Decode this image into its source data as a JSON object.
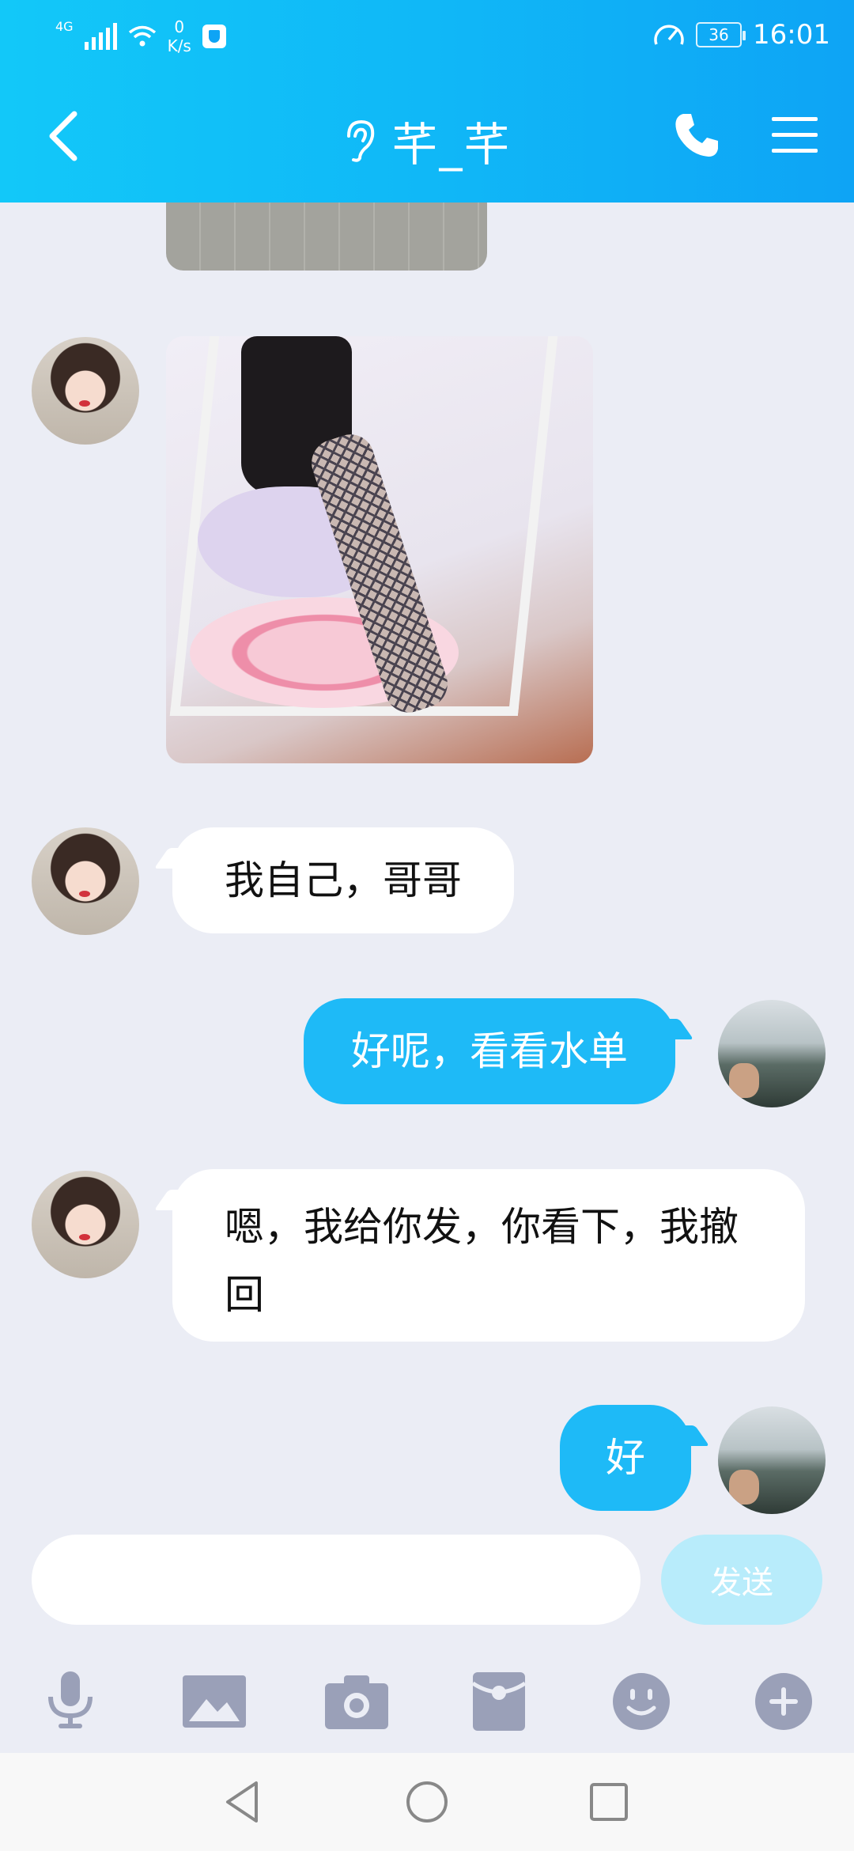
{
  "status_bar": {
    "network": "4G",
    "speed_value": "0",
    "speed_unit": "K/s",
    "battery": "36",
    "time": "16:01"
  },
  "header": {
    "title": "芊_芊",
    "icons": [
      "back-arrow-icon",
      "ear-icon",
      "phone-icon",
      "menu-icon"
    ]
  },
  "messages": [
    {
      "sender": "contact",
      "type": "image",
      "description": "partial photo"
    },
    {
      "sender": "contact",
      "type": "image",
      "description": "photo"
    },
    {
      "sender": "contact",
      "type": "text",
      "text": "我自己，哥哥"
    },
    {
      "sender": "me",
      "type": "text",
      "text": "好呢，看看水单"
    },
    {
      "sender": "contact",
      "type": "text",
      "text": "嗯，我给你发，你看下，我撤回"
    },
    {
      "sender": "me",
      "type": "text",
      "text": "好"
    }
  ],
  "composer": {
    "input_value": "",
    "send_label": "发送"
  },
  "toolbar": {
    "icons": [
      "microphone-icon",
      "image-icon",
      "camera-icon",
      "red-packet-icon",
      "emoji-icon",
      "plus-icon"
    ]
  },
  "colors": {
    "header": "#10b8f7",
    "outgoing_bubble": "#1ebaf7",
    "incoming_bubble": "#ffffff",
    "background": "#ebedf5",
    "send_button_disabled": "#b8ecfb",
    "toolbar_icons": "#9aa0b8"
  }
}
